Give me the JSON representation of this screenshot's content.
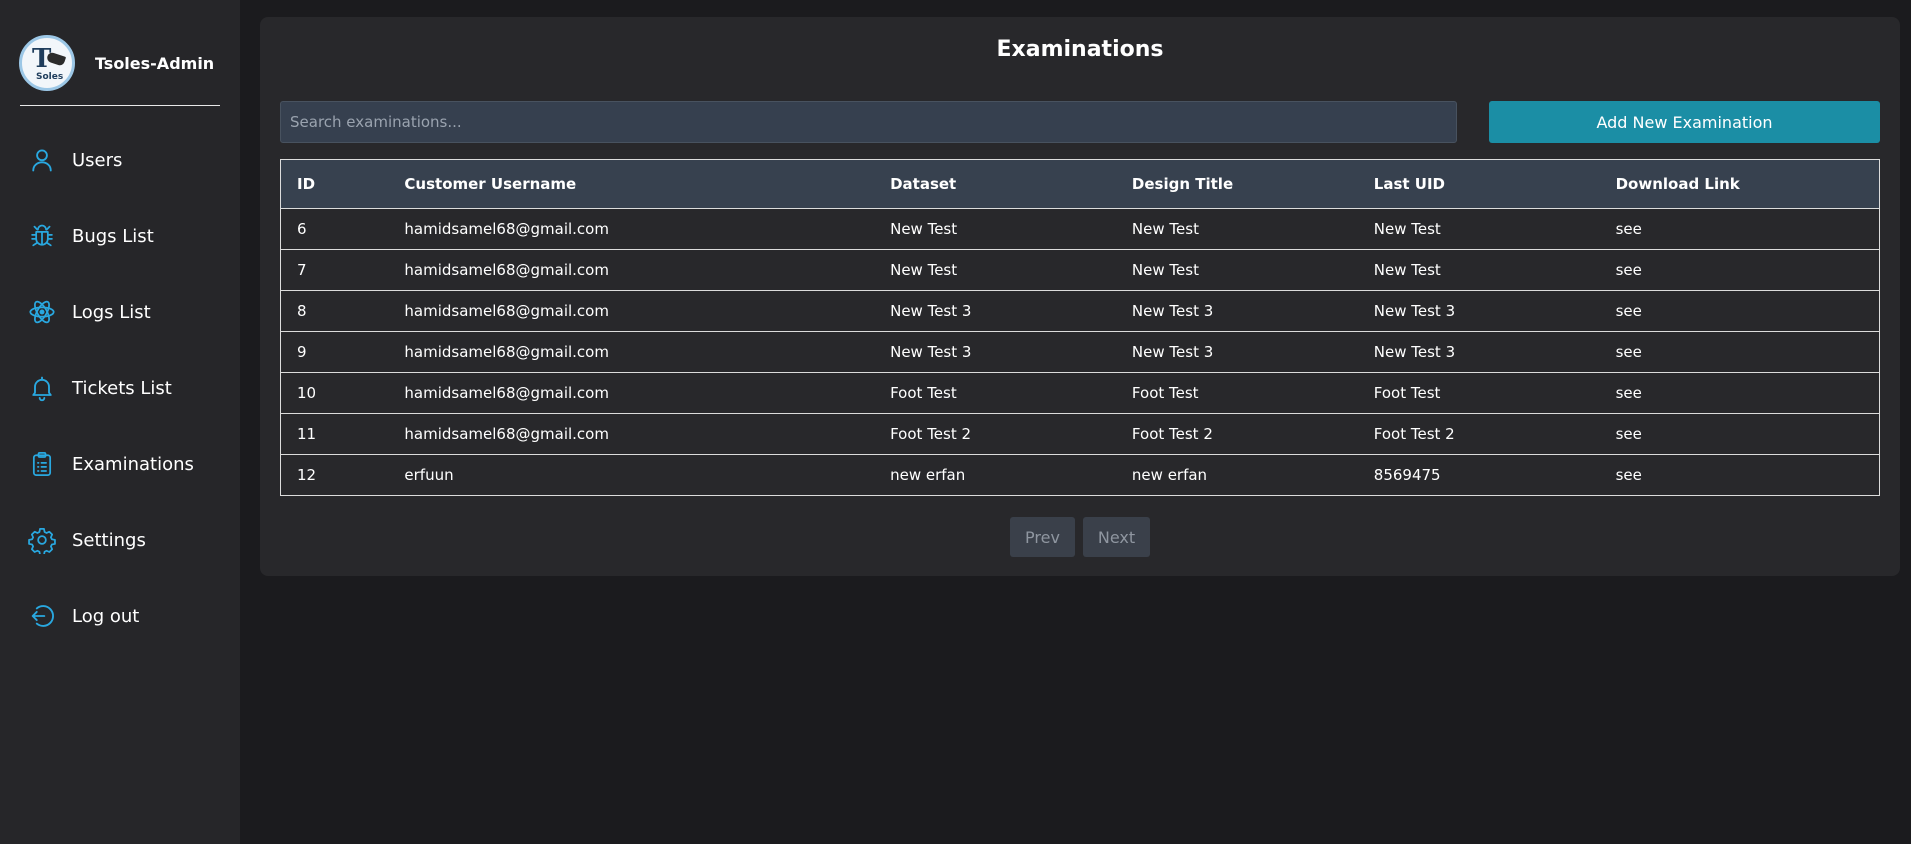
{
  "sidebar": {
    "brand_name": "Tsoles-Admin",
    "logo": {
      "letter": "T",
      "word": "Soles"
    },
    "accent_color": "#29a8e0",
    "items": [
      {
        "label": "Users",
        "icon": "user-icon"
      },
      {
        "label": "Bugs List",
        "icon": "bug-icon"
      },
      {
        "label": "Logs List",
        "icon": "atom-icon"
      },
      {
        "label": "Tickets List",
        "icon": "bell-icon"
      },
      {
        "label": "Examinations",
        "icon": "clipboard-list-icon"
      },
      {
        "label": "Settings",
        "icon": "gear-icon"
      },
      {
        "label": "Log out",
        "icon": "logout-icon"
      }
    ]
  },
  "main": {
    "title": "Examinations",
    "search": {
      "placeholder": "Search examinations...",
      "value": ""
    },
    "add_button_label": "Add New Examination",
    "add_button_color": "#1b8ea5",
    "table": {
      "headers": [
        "ID",
        "Customer Username",
        "Dataset",
        "Design Title",
        "Last UID",
        "Download Link"
      ],
      "rows": [
        [
          "6",
          "hamidsamel68@gmail.com",
          "New Test",
          "New Test",
          "New Test",
          "see"
        ],
        [
          "7",
          "hamidsamel68@gmail.com",
          "New Test",
          "New Test",
          "New Test",
          "see"
        ],
        [
          "8",
          "hamidsamel68@gmail.com",
          "New Test 3",
          "New Test 3",
          "New Test 3",
          "see"
        ],
        [
          "9",
          "hamidsamel68@gmail.com",
          "New Test 3",
          "New Test 3",
          "New Test 3",
          "see"
        ],
        [
          "10",
          "hamidsamel68@gmail.com",
          "Foot Test",
          "Foot Test",
          "Foot Test",
          "see"
        ],
        [
          "11",
          "hamidsamel68@gmail.com",
          "Foot Test 2",
          "Foot Test 2",
          "Foot Test 2",
          "see"
        ],
        [
          "12",
          "erfuun",
          "new erfan",
          "new erfan",
          "8569475",
          "see"
        ]
      ]
    },
    "pagination": {
      "prev_label": "Prev",
      "next_label": "Next"
    }
  }
}
